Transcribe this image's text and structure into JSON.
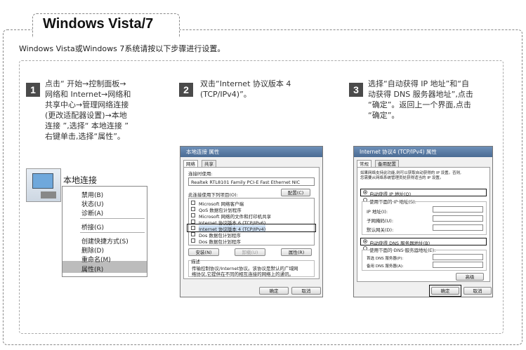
{
  "header": {
    "title": "Windows Vista/7"
  },
  "intro": "Windows Vista或Windows 7系统请按以下步骤进行设置。",
  "steps": [
    {
      "num": "1",
      "lines": [
        "点击“ 开始→控制面板→",
        "网络和 Internet→网络和",
        "共享中心→管理网络连接",
        "(更改适配器设置)→本地",
        "连接 ”,选择“ 本地连接 ”",
        "右键单击,选择“属性”。"
      ]
    },
    {
      "num": "2",
      "lines": [
        "双击“Internet 协议版本 4",
        "(TCP/IPv4)”。"
      ]
    },
    {
      "num": "3",
      "lines": [
        "选择“自动获得 IP 地址”和“自",
        "动获得 DNS 服务器地址”,点击",
        "“确定”。返回上一个界面,点击",
        "“确定”。"
      ]
    }
  ],
  "context_menu": {
    "label": "本地连接",
    "items": [
      "禁用(B)",
      "状态(U)",
      "诊断(A)",
      "桥接(G)",
      "创建快捷方式(S)",
      "删除(D)",
      "重命名(M)",
      "属性(R)"
    ]
  },
  "dialog1": {
    "title": "本地连接 属性",
    "tabs": [
      "网络",
      "共享"
    ],
    "connect_using": "连接时使用:",
    "adapter": "Realtek RTL8101 Family PCI-E Fast Ethernet NIC",
    "configure": "配置(C)",
    "items_label": "此连接使用下列项目(O):",
    "items": [
      "Microsoft 网络客户端",
      "QoS 数据包计划程序",
      "Microsoft 网络的文件和打印机共享",
      "Internet 协议版本 6 (TCP/IPv6)",
      "Internet 协议版本 4 (TCP/IPv4)",
      "Dos 数据包计划程序",
      "Dos 数据包计划程序"
    ],
    "install": "安装(N)",
    "uninstall": "卸载(U)",
    "properties": "属性(R)",
    "desc_title": "描述",
    "desc_lines": [
      "传输控制协议/Internet协议。该协议是默认的广域网",
      "络协议,它提供在不同的相互连接的网络上的通讯。"
    ],
    "ok": "确定",
    "cancel": "取消"
  },
  "dialog2": {
    "title": "Internet 协议4 (TCP/IPv4) 属性",
    "tabs": [
      "常规",
      "备用配置"
    ],
    "desc_lines": [
      "如果网络支持此功能,则可以获取自动获得的 IP 设置。否则,",
      "您需要从网络系统管理员处获得适当的 IP 设置。"
    ],
    "auto_ip": "自动获得 IP 地址(O)",
    "manual_ip": "使用下面的 IP 地址(S):",
    "ip_label": "IP 地址(I):",
    "mask_label": "子网掩码(U):",
    "gateway_label": "默认网关(D):",
    "auto_dns": "自动获得 DNS 服务器地址(B)",
    "manual_dns": "使用下面的 DNS 服务器地址(E):",
    "dns1_label": "首选 DNS 服务器(P):",
    "dns2_label": "备用 DNS 服务器(A):",
    "advanced": "高级",
    "ok": "确定",
    "cancel": "取消"
  }
}
